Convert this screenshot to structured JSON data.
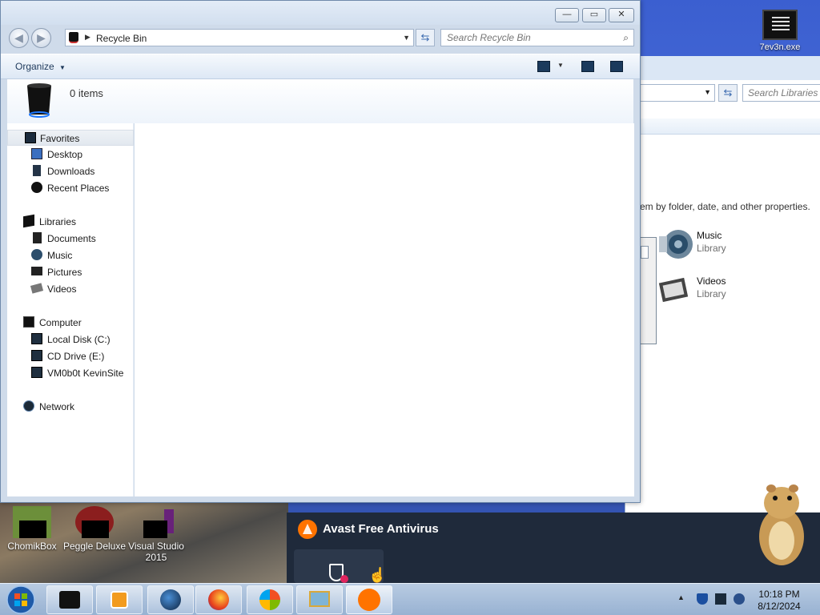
{
  "window": {
    "title_min": "—",
    "title_max": "▭",
    "title_close": "✕",
    "address": "Recycle Bin",
    "search_placeholder": "Search Recycle Bin",
    "organize_label": "Organize",
    "item_count": "0 items"
  },
  "nav_pane": {
    "favorites": {
      "label": "Favorites",
      "items": [
        "Desktop",
        "Downloads",
        "Recent Places"
      ]
    },
    "libraries": {
      "label": "Libraries",
      "items": [
        "Documents",
        "Music",
        "Pictures",
        "Videos"
      ]
    },
    "computer": {
      "label": "Computer",
      "items": [
        "Local Disk (C:)",
        "CD Drive (E:)",
        "VM0b0t KevinSite"
      ]
    },
    "network": {
      "label": "Network"
    }
  },
  "background_window": {
    "search_placeholder": "Search Libraries",
    "hint": "em by folder, date, and other properties.",
    "libraries": [
      {
        "name": "Music",
        "type": "Library"
      },
      {
        "name": "Videos",
        "type": "Library"
      }
    ]
  },
  "desktop_icons": {
    "top_right": "7ev3n.exe",
    "chomikbox": "ChomikBox",
    "peggle": "Peggle Deluxe",
    "visual_studio": "Visual Studio 2015"
  },
  "notification": {
    "title": "Avast Free Antivirus"
  },
  "taskbar": {
    "time": "10:18 PM",
    "date": "8/12/2024"
  },
  "colors": {
    "accent": "#3c6bb0",
    "avast_orange": "#ff7300",
    "avast_bg": "#1f2a3b"
  }
}
